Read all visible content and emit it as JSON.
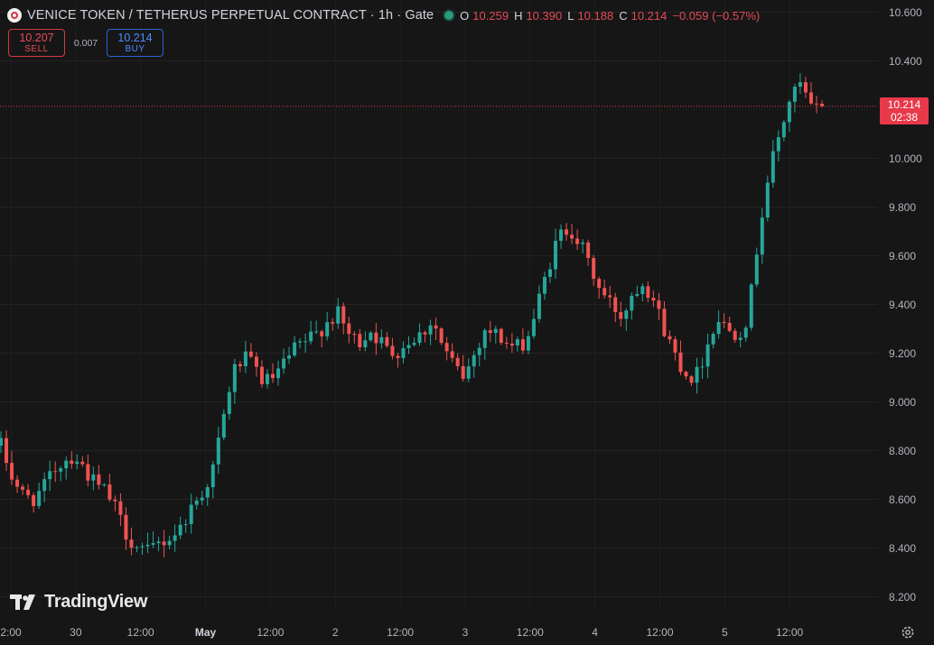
{
  "header": {
    "title": "VENICE TOKEN / TETHERUS PERPETUAL CONTRACT · 1h · Gate",
    "ohlc": [
      {
        "k": "O",
        "v": "10.259"
      },
      {
        "k": "H",
        "v": "10.390"
      },
      {
        "k": "L",
        "v": "10.188"
      },
      {
        "k": "C",
        "v": "10.214"
      }
    ],
    "change": "−0.059 (−0.57%)"
  },
  "trade": {
    "sell_price": "10.207",
    "sell_label": "SELL",
    "spread": "0.007",
    "buy_price": "10.214",
    "buy_label": "BUY"
  },
  "price_tag": {
    "price": "10.214",
    "countdown": "02:38"
  },
  "axis": {
    "y_labels": [
      "10.600",
      "10.400",
      "10.000",
      "9.800",
      "9.600",
      "9.400",
      "9.200",
      "9.000",
      "8.800",
      "8.600",
      "8.400",
      "8.200"
    ],
    "x_labels": [
      {
        "t": "2:00",
        "bold": false
      },
      {
        "t": "30",
        "bold": false
      },
      {
        "t": "12:00",
        "bold": false
      },
      {
        "t": "May",
        "bold": true
      },
      {
        "t": "12:00",
        "bold": false
      },
      {
        "t": "2",
        "bold": false
      },
      {
        "t": "12:00",
        "bold": false
      },
      {
        "t": "3",
        "bold": false
      },
      {
        "t": "12:00",
        "bold": false
      },
      {
        "t": "4",
        "bold": false
      },
      {
        "t": "12:00",
        "bold": false
      },
      {
        "t": "5",
        "bold": false
      },
      {
        "t": "12:00",
        "bold": false
      }
    ]
  },
  "branding": {
    "name": "TradingView"
  },
  "colors": {
    "up": "#26a69a",
    "down": "#ef5350",
    "background": "#161616",
    "last_price": "#e8394a"
  },
  "chart_data": {
    "type": "candlestick",
    "interval": "1h",
    "ylim": [
      8.15,
      10.65
    ],
    "last_price": 10.214,
    "keypoints": [
      8.82,
      8.7,
      8.62,
      8.6,
      8.64,
      8.72,
      8.76,
      8.78,
      8.72,
      8.66,
      8.63,
      8.55,
      8.45,
      8.4,
      8.38,
      8.42,
      8.44,
      8.48,
      8.56,
      8.62,
      8.7,
      8.9,
      9.12,
      9.18,
      9.15,
      9.08,
      9.1,
      9.16,
      9.22,
      9.25,
      9.28,
      9.33,
      9.36,
      9.28,
      9.24,
      9.3,
      9.25,
      9.2,
      9.22,
      9.26,
      9.28,
      9.34,
      9.22,
      9.15,
      9.1,
      9.2,
      9.3,
      9.28,
      9.24,
      9.22,
      9.26,
      9.4,
      9.55,
      9.68,
      9.72,
      9.65,
      9.55,
      9.45,
      9.4,
      9.35,
      9.45,
      9.5,
      9.42,
      9.3,
      9.2,
      9.12,
      9.1,
      9.22,
      9.35,
      9.3,
      9.28,
      9.35,
      9.7,
      9.95,
      10.1,
      10.25,
      10.3,
      10.2,
      10.214
    ]
  }
}
